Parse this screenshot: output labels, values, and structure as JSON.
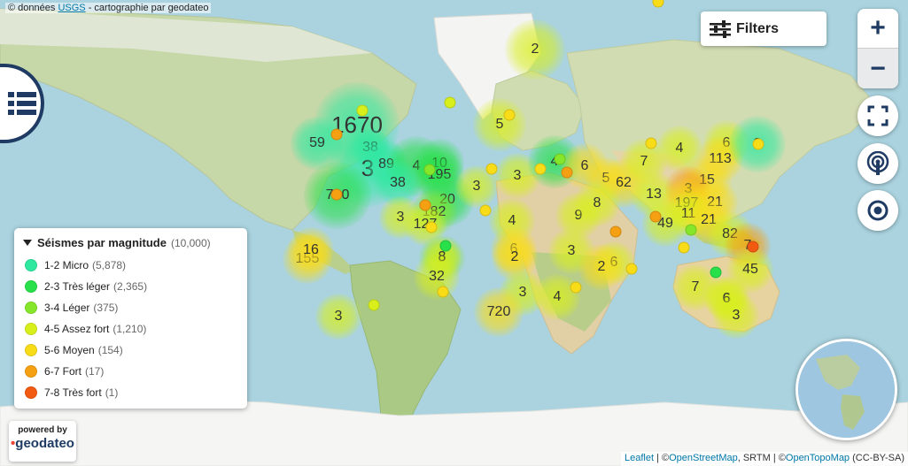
{
  "attribution_top": {
    "prefix": "© données",
    "link": "USGS",
    "suffix": "- cartographie par geodateo"
  },
  "filters": {
    "label": "Filters",
    "icon": "sliders-icon"
  },
  "zoom": {
    "in_label": "+",
    "out_label": "−"
  },
  "controls": [
    "fullscreen-icon",
    "broadcast-icon",
    "locate-icon"
  ],
  "list_toggle_icon": "list-icon",
  "legend": {
    "title": "Séismes par magnitude",
    "total": "(10,000)",
    "items": [
      {
        "label": "1-2 Micro",
        "count": "(5,878)",
        "color": "#2ee8a0"
      },
      {
        "label": "2-3 Très léger",
        "count": "(2,365)",
        "color": "#28e04a"
      },
      {
        "label": "3-4 Léger",
        "count": "(375)",
        "color": "#86e62a"
      },
      {
        "label": "4-5 Assez fort",
        "count": "(1,210)",
        "color": "#d8ef1c"
      },
      {
        "label": "5-6 Moyen",
        "count": "(154)",
        "color": "#f9dc18"
      },
      {
        "label": "6-7 Fort",
        "count": "(17)",
        "color": "#f5a012"
      },
      {
        "label": "7-8 Très fort",
        "count": "(1)",
        "color": "#f25a12"
      }
    ]
  },
  "powered": {
    "line1": "powered by",
    "brand": "geodateo"
  },
  "attribution_bottom": {
    "leaflet": "Leaflet",
    "sep1": " | ©",
    "osm": "OpenStreetMap",
    "srtm": ", SRTM",
    "sep2": " | ©",
    "otm": "OpenTopoMap",
    "lic": " (CC-BY-SA)"
  },
  "clusters": [
    {
      "label": "2",
      "level": 4
    },
    {
      "label": "5",
      "level": 4
    },
    {
      "label": "1670",
      "level": 1
    },
    {
      "label": "59",
      "level": 1
    },
    {
      "label": "38",
      "level": 1
    },
    {
      "label": "3",
      "level": 1
    },
    {
      "label": "89",
      "level": 1
    },
    {
      "label": "4",
      "level": 2
    },
    {
      "label": "10",
      "level": 2
    },
    {
      "label": "195",
      "level": 2
    },
    {
      "label": "38",
      "level": 1
    },
    {
      "label": "730",
      "level": 2
    },
    {
      "label": "20",
      "level": 2
    },
    {
      "label": "3",
      "level": 4
    },
    {
      "label": "3",
      "level": 4
    },
    {
      "label": "182",
      "level": 3
    },
    {
      "label": "3",
      "level": 4
    },
    {
      "label": "127",
      "level": 4
    },
    {
      "label": "4",
      "level": 4
    },
    {
      "label": "4",
      "level": 2
    },
    {
      "label": "6",
      "level": 5
    },
    {
      "label": "5",
      "level": 5
    },
    {
      "label": "62",
      "level": 5
    },
    {
      "label": "7",
      "level": 4
    },
    {
      "label": "4",
      "level": 4
    },
    {
      "label": "6",
      "level": 4
    },
    {
      "label": "113",
      "level": 5
    },
    {
      "label": "15",
      "level": 5
    },
    {
      "label": "13",
      "level": 4
    },
    {
      "label": "3",
      "level": 6
    },
    {
      "label": "197",
      "level": 5
    },
    {
      "label": "21",
      "level": 5
    },
    {
      "label": "11",
      "level": 4
    },
    {
      "label": "49",
      "level": 4
    },
    {
      "label": "21",
      "level": 5
    },
    {
      "label": "82",
      "level": 4
    },
    {
      "label": "7",
      "level": 6
    },
    {
      "label": "45",
      "level": 4
    },
    {
      "label": "9",
      "level": 4
    },
    {
      "label": "8",
      "level": 4
    },
    {
      "label": "6",
      "level": 4
    },
    {
      "label": "155",
      "level": 5
    },
    {
      "label": "16",
      "level": 5
    },
    {
      "label": "5",
      "level": 3
    },
    {
      "label": "8",
      "level": 4
    },
    {
      "label": "32",
      "level": 4
    },
    {
      "label": "6",
      "level": 5
    },
    {
      "label": "2",
      "level": 5
    },
    {
      "label": "3",
      "level": 4
    },
    {
      "label": "2",
      "level": 5
    },
    {
      "label": "6",
      "level": 4
    },
    {
      "label": "3",
      "level": 4
    },
    {
      "label": "4",
      "level": 4
    },
    {
      "label": "720",
      "level": 5
    },
    {
      "label": "7",
      "level": 4
    },
    {
      "label": "6",
      "level": 4
    },
    {
      "label": "3",
      "level": 4
    },
    {
      "label": "3",
      "level": 4
    },
    {
      "label": "2",
      "level": 1
    }
  ]
}
